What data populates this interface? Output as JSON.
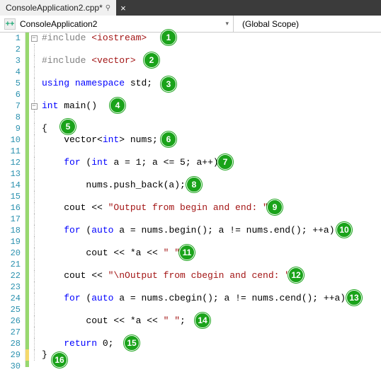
{
  "tab": {
    "title": "ConsoleApplication2.cpp*",
    "close_glyph": "×",
    "pin_glyph": "⚲"
  },
  "context": {
    "left": "ConsoleApplication2",
    "right": "(Global Scope)",
    "dd_glyph": "▾"
  },
  "gutter_lines": [
    "1",
    "2",
    "3",
    "4",
    "5",
    "6",
    "7",
    "8",
    "9",
    "10",
    "11",
    "12",
    "13",
    "14",
    "15",
    "16",
    "17",
    "18",
    "19",
    "20",
    "21",
    "22",
    "23",
    "24",
    "25",
    "26",
    "27",
    "28",
    "29",
    "30"
  ],
  "fold": {
    "minus": "−"
  },
  "code": {
    "l1a": "#include ",
    "l1b": "<iostream>",
    "l3a": "#include ",
    "l3b": "<vector>",
    "l5a": "using",
    "l5b": " ",
    "l5c": "namespace",
    "l5d": " std;",
    "l7": "int",
    "l7b": " main()",
    "l9": "{",
    "l10a": "    vector<",
    "l10b": "int",
    "l10c": "> nums;",
    "l12a": "    ",
    "l12b": "for",
    "l12c": " (",
    "l12d": "int",
    "l12e": " a = 1; a <= 5; a++)",
    "l14": "        nums.push_back(a);",
    "l16a": "    cout << ",
    "l16b": "\"Output from begin and end: \"",
    "l16c": ";",
    "l18a": "    ",
    "l18b": "for",
    "l18c": " (",
    "l18d": "auto",
    "l18e": " a = nums.begin(); a != nums.end(); ++a)",
    "l20a": "        cout << *a << ",
    "l20b": "\" \"",
    "l20c": ";",
    "l22a": "    cout << ",
    "l22b": "\"\\nOutput from cbegin and cend: \"",
    "l22c": ";",
    "l24a": "    ",
    "l24b": "for",
    "l24c": " (",
    "l24d": "auto",
    "l24e": " a = nums.cbegin(); a != nums.cend(); ++a)",
    "l26a": "        cout << *a << ",
    "l26b": "\" \"",
    "l26c": ";",
    "l28a": "    ",
    "l28b": "return",
    "l28c": " 0;",
    "l29": "}"
  },
  "badges": [
    "1",
    "2",
    "3",
    "4",
    "5",
    "6",
    "7",
    "8",
    "9",
    "10",
    "11",
    "12",
    "13",
    "14",
    "15",
    "16"
  ]
}
